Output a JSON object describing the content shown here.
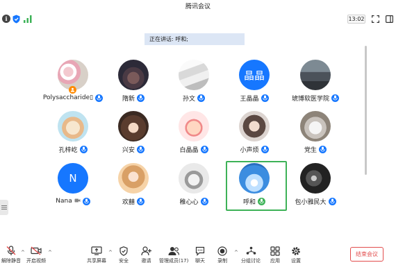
{
  "window": {
    "title": "腾讯会议"
  },
  "topbar": {
    "timer": "13:02"
  },
  "speaker_banner": {
    "prefix": "正在讲话: ",
    "name": "呼和;"
  },
  "colors": {
    "accent": "#1677ff",
    "active_speaker": "#3db257",
    "end_button": "#e24c4c",
    "banner_bg": "#dce6f5",
    "host_badge": "#ff8a00"
  },
  "participants": [
    {
      "name": "Polysaccharide\u0000",
      "name_display": "Polysaccharide▯",
      "avatar": "photo-flowers",
      "host": true
    },
    {
      "name": "隋新",
      "avatar": "photo-animal"
    },
    {
      "name": "孙文",
      "avatar": "photo-sign"
    },
    {
      "name": "王晶晶",
      "avatar": "initial",
      "initial": "晶晶"
    },
    {
      "name": "琥博软医学院",
      "avatar": "photo-tower"
    },
    {
      "name": "孔梓屹",
      "avatar": "photo-cat"
    },
    {
      "name": "兴安",
      "avatar": "photo-anime-girl"
    },
    {
      "name": "白晶晶",
      "avatar": "photo-cartoon-kid"
    },
    {
      "name": "小声烦",
      "avatar": "photo-girl"
    },
    {
      "name": "党生",
      "avatar": "photo-bird"
    },
    {
      "name": "Nana",
      "avatar": "initial",
      "initial": "N",
      "extra_icon": "video-off-icon"
    },
    {
      "name": "欢囍",
      "avatar": "photo-anime-girl2"
    },
    {
      "name": "稚心心",
      "avatar": "photo-bunny"
    },
    {
      "name": "呼和",
      "avatar": "photo-sky",
      "speaking": true
    },
    {
      "name": "包小雅民大",
      "avatar": "photo-dark"
    }
  ],
  "toolbar": {
    "unmute": "解除静音",
    "start_video": "开启视频",
    "share_screen": "共享屏幕",
    "security": "安全",
    "invite": "邀请",
    "manage_members": "管理成员(17)",
    "chat": "聊天",
    "record": "录制",
    "breakout": "分组讨论",
    "apps": "应用",
    "settings": "设置",
    "end_meeting": "结束会议"
  }
}
